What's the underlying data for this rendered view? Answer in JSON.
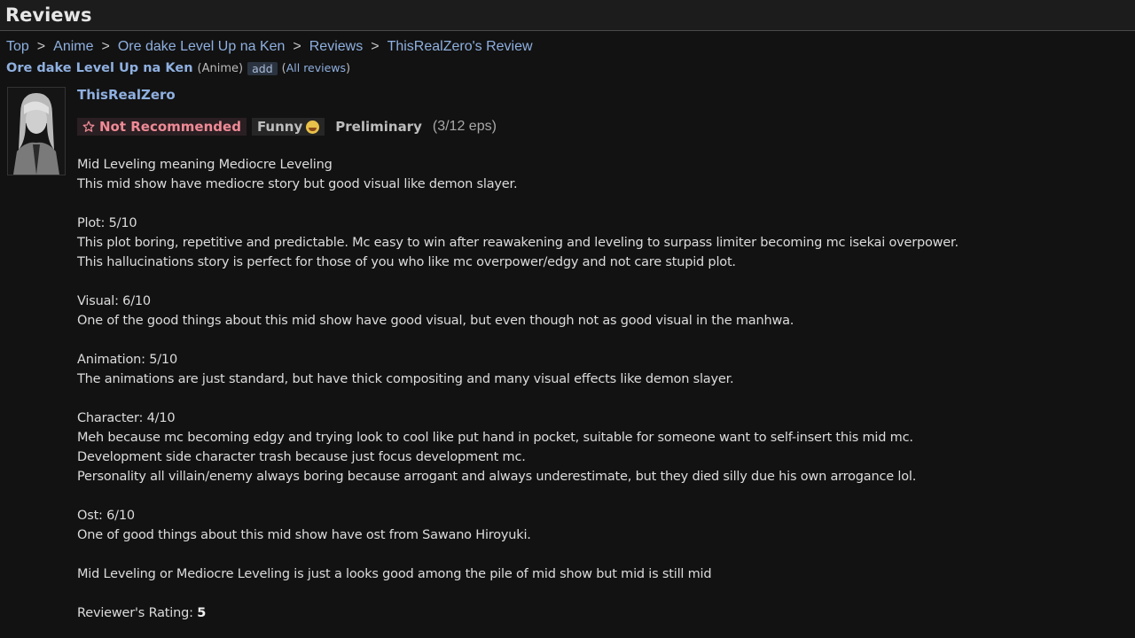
{
  "header": {
    "title": "Reviews"
  },
  "breadcrumb": {
    "items": [
      "Top",
      "Anime",
      "Ore dake Level Up na Ken",
      "Reviews",
      "ThisRealZero's Review"
    ],
    "separator": ">"
  },
  "anime": {
    "title": "Ore dake Level Up na Ken",
    "type": "(Anime)",
    "add_label": "add",
    "all_reviews_open": "(",
    "all_reviews_label": "All reviews",
    "all_reviews_close": ")"
  },
  "review": {
    "username": "ThisRealZero",
    "recommendation": "Not Recommended",
    "reaction": "Funny",
    "status": "Preliminary",
    "episodes": "(3/12 eps)",
    "paragraphs": [
      [
        "Mid Leveling meaning Mediocre Leveling",
        "This mid show have mediocre story but good visual like demon slayer."
      ],
      [
        "Plot: 5/10",
        "This plot boring, repetitive and predictable. Mc easy to win after reawakening and leveling to surpass limiter becoming mc isekai overpower.",
        "This hallucinations story is perfect for those of you who like mc overpower/edgy and not care stupid plot."
      ],
      [
        "Visual: 6/10",
        "One of the good things about this mid show have good visual, but even though not as good visual in the manhwa."
      ],
      [
        "Animation: 5/10",
        "The animations are just standard, but have thick compositing and many visual effects like demon slayer."
      ],
      [
        "Character: 4/10",
        "Meh because mc becoming edgy and trying look to cool like put hand in pocket, suitable for someone want to self-insert this mid mc.",
        "Development side character trash because just focus development mc.",
        "Personality all villain/enemy always boring because arrogant and always underestimate, but they died silly due his own arrogance lol."
      ],
      [
        "Ost: 6/10",
        "One of good things about this mid show have ost from Sawano Hiroyuki."
      ],
      [
        "Mid Leveling or Mediocre Leveling is just a looks good among the pile of mid show but mid is still mid"
      ]
    ],
    "rating_label": "Reviewer's Rating:",
    "rating_value": "5"
  },
  "colors": {
    "link": "#8fb0e0",
    "not_recommended": "#ef8a96",
    "background": "#121212"
  }
}
